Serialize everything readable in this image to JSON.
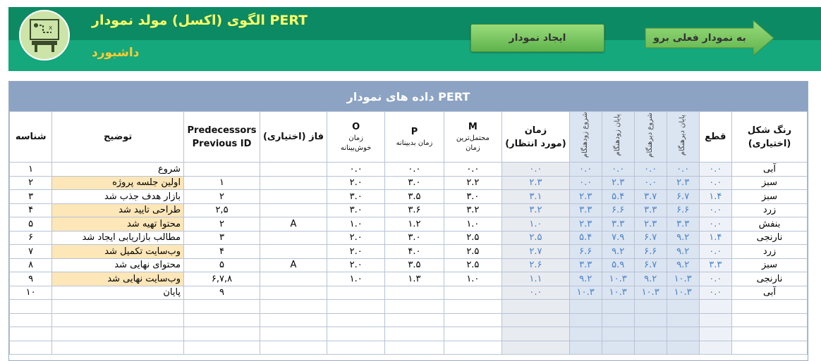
{
  "header": {
    "title": "الگوی (اکسل) مولد نمودار PERT",
    "subtitle": "داشبورد",
    "create_button": "ایجاد نمودار",
    "goto_button": "به نمودار فعلی برو"
  },
  "table": {
    "title": "داده های نمودار PERT",
    "headers": {
      "id": "شناسه",
      "desc": "توضیح",
      "pred_line1": "Predecessors",
      "pred_line2": "Previous ID",
      "phase": "فاز (اختیاری)",
      "o": "O",
      "o_sub1": "زمان",
      "o_sub2": "خوش‌بینانه",
      "p": "P",
      "p_sub": "زمان بدبینانه",
      "m": "M",
      "m_sub1": "محتمل‌ترین",
      "m_sub2": "زمان",
      "exp1": "زمان",
      "exp2": "(مورد انتظار)",
      "es": "شروع زودهنگام",
      "ef": "پایان زودهنگام",
      "ls": "شروع دیرهنگام",
      "lf": "پایان دیرهنگام",
      "float": "قطع",
      "color1": "رنگ شکل",
      "color2": "(اختیاری)"
    },
    "rows": [
      {
        "id": "۱",
        "desc": "شروع",
        "pred": "",
        "phase": "",
        "o": "۰.۰",
        "p": "۰.۰",
        "m": "۰.۰",
        "exp": "۰.۰",
        "es": "۰.۰",
        "ef": "۰.۰",
        "ls": "۰.۰",
        "lf": "۰.۰",
        "float": "۰.۰",
        "color": "آبی",
        "hl": false
      },
      {
        "id": "۲",
        "desc": "اولین جلسه پروژه",
        "pred": "۱",
        "phase": "",
        "o": "۲.۰",
        "p": "۳.۰",
        "m": "۲.۲",
        "exp": "۲.۳",
        "es": "۰.۰",
        "ef": "۲.۳",
        "ls": "۰.۰",
        "lf": "۲.۳",
        "float": "۰.۰",
        "color": "سبز",
        "hl": true
      },
      {
        "id": "۳",
        "desc": "بازار هدف جذب شد",
        "pred": "۲",
        "phase": "",
        "o": "۳.۰",
        "p": "۳.۵",
        "m": "۳.۰",
        "exp": "۳.۱",
        "es": "۲.۳",
        "ef": "۵.۴",
        "ls": "۳.۷",
        "lf": "۶.۷",
        "float": "۱.۴",
        "color": "سبز",
        "hl": false
      },
      {
        "id": "۴",
        "desc": "طراحی تایید شد",
        "pred": "۲,۵",
        "phase": "",
        "o": "۳.۰",
        "p": "۳.۶",
        "m": "۳.۲",
        "exp": "۳.۲",
        "es": "۳.۳",
        "ef": "۶.۶",
        "ls": "۳.۳",
        "lf": "۶.۶",
        "float": "۰.۰",
        "color": "زرد",
        "hl": true
      },
      {
        "id": "۵",
        "desc": "محتوا تهیه شد",
        "pred": "۲",
        "phase": "A",
        "o": "۱.۰",
        "p": "۱.۲",
        "m": "۱.۰",
        "exp": "۱.۰",
        "es": "۲.۳",
        "ef": "۳.۳",
        "ls": "۲.۳",
        "lf": "۳.۳",
        "float": "۰.۰",
        "color": "بنفش",
        "hl": true
      },
      {
        "id": "۶",
        "desc": "مطالب بازاریابی ایجاد شد",
        "pred": "۳",
        "phase": "",
        "o": "۲.۰",
        "p": "۳.۰",
        "m": "۲.۵",
        "exp": "۲.۵",
        "es": "۵.۴",
        "ef": "۷.۹",
        "ls": "۶.۷",
        "lf": "۹.۲",
        "float": "۱.۴",
        "color": "نارنجی",
        "hl": false
      },
      {
        "id": "۷",
        "desc": "وب‌سایت تکمیل شد",
        "pred": "۴",
        "phase": "",
        "o": "۲.۰",
        "p": "۴.۰",
        "m": "۲.۵",
        "exp": "۲.۷",
        "es": "۶.۶",
        "ef": "۹.۲",
        "ls": "۶.۶",
        "lf": "۹.۲",
        "float": "۰.۰",
        "color": "زرد",
        "hl": true
      },
      {
        "id": "۸",
        "desc": "محتوای نهایی شد",
        "pred": "۵",
        "phase": "A",
        "o": "۲.۰",
        "p": "۳.۵",
        "m": "۲.۵",
        "exp": "۲.۶",
        "es": "۳.۳",
        "ef": "۵.۹",
        "ls": "۶.۷",
        "lf": "۹.۲",
        "float": "۳.۳",
        "color": "سبز",
        "hl": false
      },
      {
        "id": "۹",
        "desc": "وب‌سایت نهایی شد",
        "pred": "۶,۷,۸",
        "phase": "",
        "o": "۱.۰",
        "p": "۱.۳",
        "m": "۱.۰",
        "exp": "۱.۱",
        "es": "۹.۲",
        "ef": "۱۰.۳",
        "ls": "۹.۲",
        "lf": "۱۰.۳",
        "float": "۰.۰",
        "color": "نارنجی",
        "hl": true
      },
      {
        "id": "۱۰",
        "desc": "پایان",
        "pred": "۹",
        "phase": "",
        "o": "",
        "p": "",
        "m": "",
        "exp": "۰.۰",
        "es": "۱۰.۳",
        "ef": "۱۰.۳",
        "ls": "۱۰.۳",
        "lf": "۱۰.۳",
        "float": "۰.۰",
        "color": "آبی",
        "hl": false
      },
      {
        "id": "",
        "desc": "",
        "pred": "",
        "phase": "",
        "o": "",
        "p": "",
        "m": "",
        "exp": "",
        "es": "",
        "ef": "",
        "ls": "",
        "lf": "",
        "float": "",
        "color": "",
        "hl": false
      },
      {
        "id": "",
        "desc": "",
        "pred": "",
        "phase": "",
        "o": "",
        "p": "",
        "m": "",
        "exp": "",
        "es": "",
        "ef": "",
        "ls": "",
        "lf": "",
        "float": "",
        "color": "",
        "hl": false
      },
      {
        "id": "",
        "desc": "",
        "pred": "",
        "phase": "",
        "o": "",
        "p": "",
        "m": "",
        "exp": "",
        "es": "",
        "ef": "",
        "ls": "",
        "lf": "",
        "float": "",
        "color": "",
        "hl": false
      },
      {
        "id": "",
        "desc": "",
        "pred": "",
        "phase": "",
        "o": "",
        "p": "",
        "m": "",
        "exp": "",
        "es": "",
        "ef": "",
        "ls": "",
        "lf": "",
        "float": "",
        "color": "",
        "hl": false
      }
    ]
  }
}
